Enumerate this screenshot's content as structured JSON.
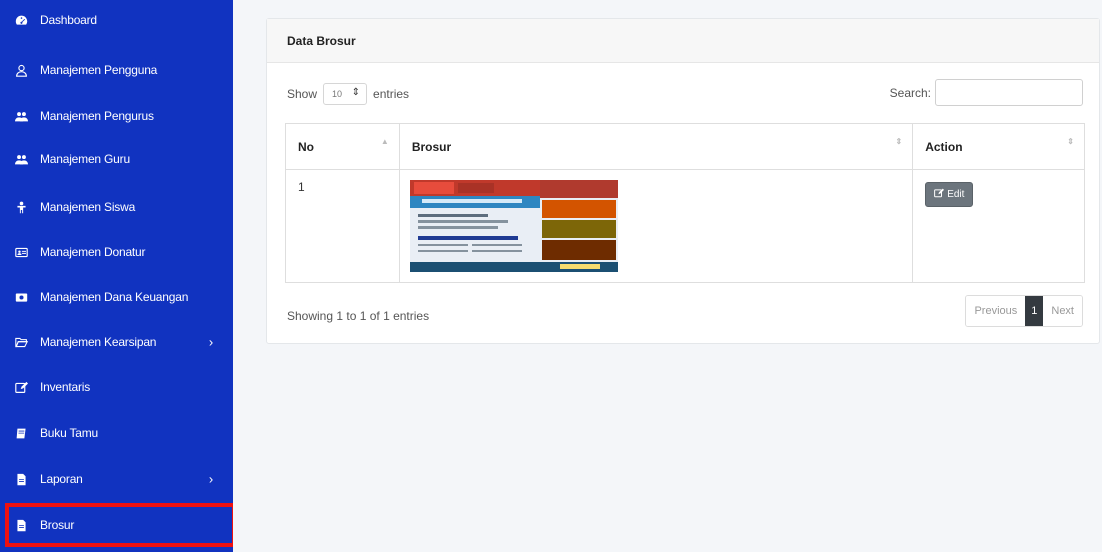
{
  "sidebar": {
    "items": [
      {
        "label": "Dashboard",
        "icon": "tachometer-icon"
      },
      {
        "label": "Manajemen Pengguna",
        "icon": "user-icon"
      },
      {
        "label": "Manajemen Pengurus",
        "icon": "users-icon"
      },
      {
        "label": "Manajemen Guru",
        "icon": "users-icon"
      },
      {
        "label": "Manajemen Siswa",
        "icon": "child-icon"
      },
      {
        "label": "Manajemen Donatur",
        "icon": "id-card-icon"
      },
      {
        "label": "Manajemen Dana Keuangan",
        "icon": "money-icon"
      },
      {
        "label": "Manajemen Kearsipan",
        "icon": "folder-open-icon",
        "chevron": "›"
      },
      {
        "label": "Inventaris",
        "icon": "edit-icon"
      },
      {
        "label": "Buku Tamu",
        "icon": "book-icon"
      },
      {
        "label": "Laporan",
        "icon": "file-icon",
        "chevron": "›"
      },
      {
        "label": "Brosur",
        "icon": "file-icon"
      }
    ],
    "active_item": "Brosur"
  },
  "card": {
    "title": "Data Brosur",
    "show_label": "Show",
    "entries_count": "10",
    "entries_label": "entries",
    "search_label": "Search:",
    "search_value": ""
  },
  "table": {
    "headers": [
      "No",
      "Brosur",
      "Action"
    ],
    "rows": [
      {
        "no": "1",
        "action_label": "Edit"
      }
    ]
  },
  "footer": {
    "info": "Showing 1 to 1 of 1 entries",
    "previous_label": "Previous",
    "current_page": "1",
    "next_label": "Next"
  },
  "colors": {
    "sidebar_bg": "#1133c0",
    "active_outline": "#ee1111",
    "edit_button": "#6c757d",
    "current_page": "#343a40"
  }
}
